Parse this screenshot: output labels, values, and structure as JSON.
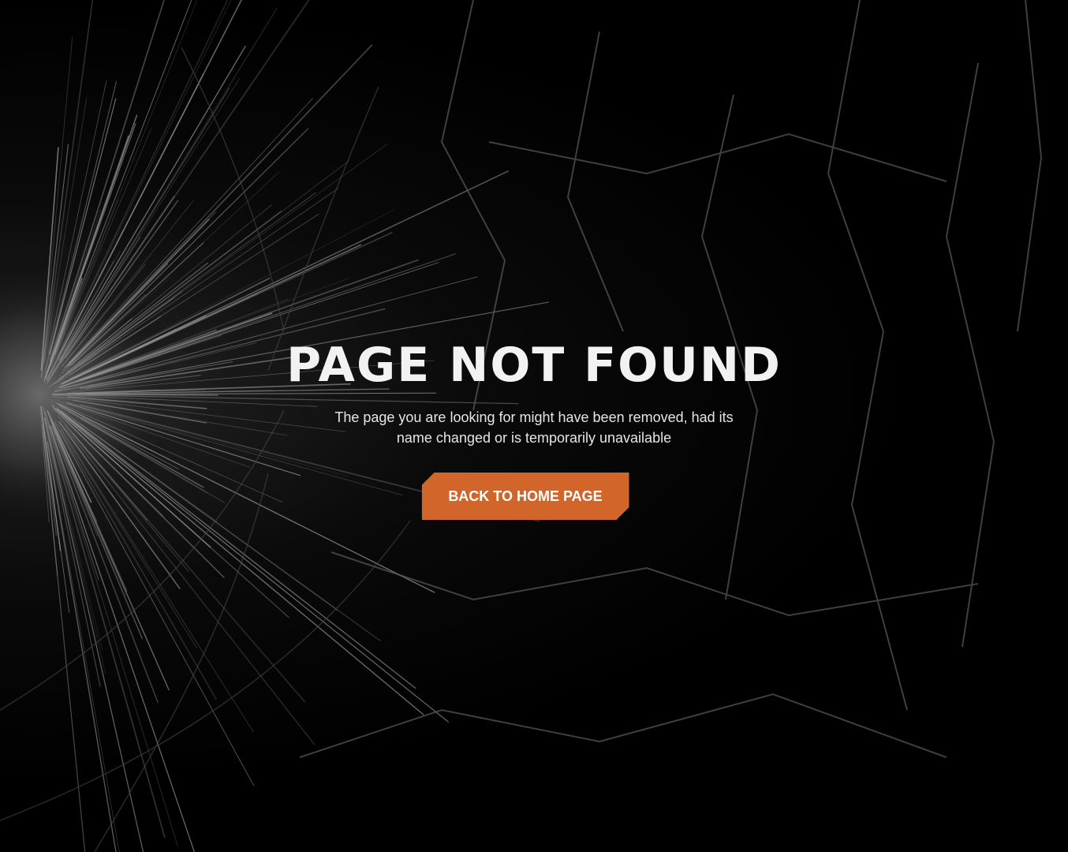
{
  "error_page": {
    "title": "PAGE NOT FOUND",
    "message": "The page you are looking for might have been removed, had its name changed or is temporarily unavailable",
    "button_label": "BACK TO HOME PAGE"
  },
  "colors": {
    "background": "#000000",
    "accent": "#d2652a",
    "title_text": "#f2f2f2",
    "body_text": "#e6e6e6"
  },
  "background_image": "shattered-glass"
}
